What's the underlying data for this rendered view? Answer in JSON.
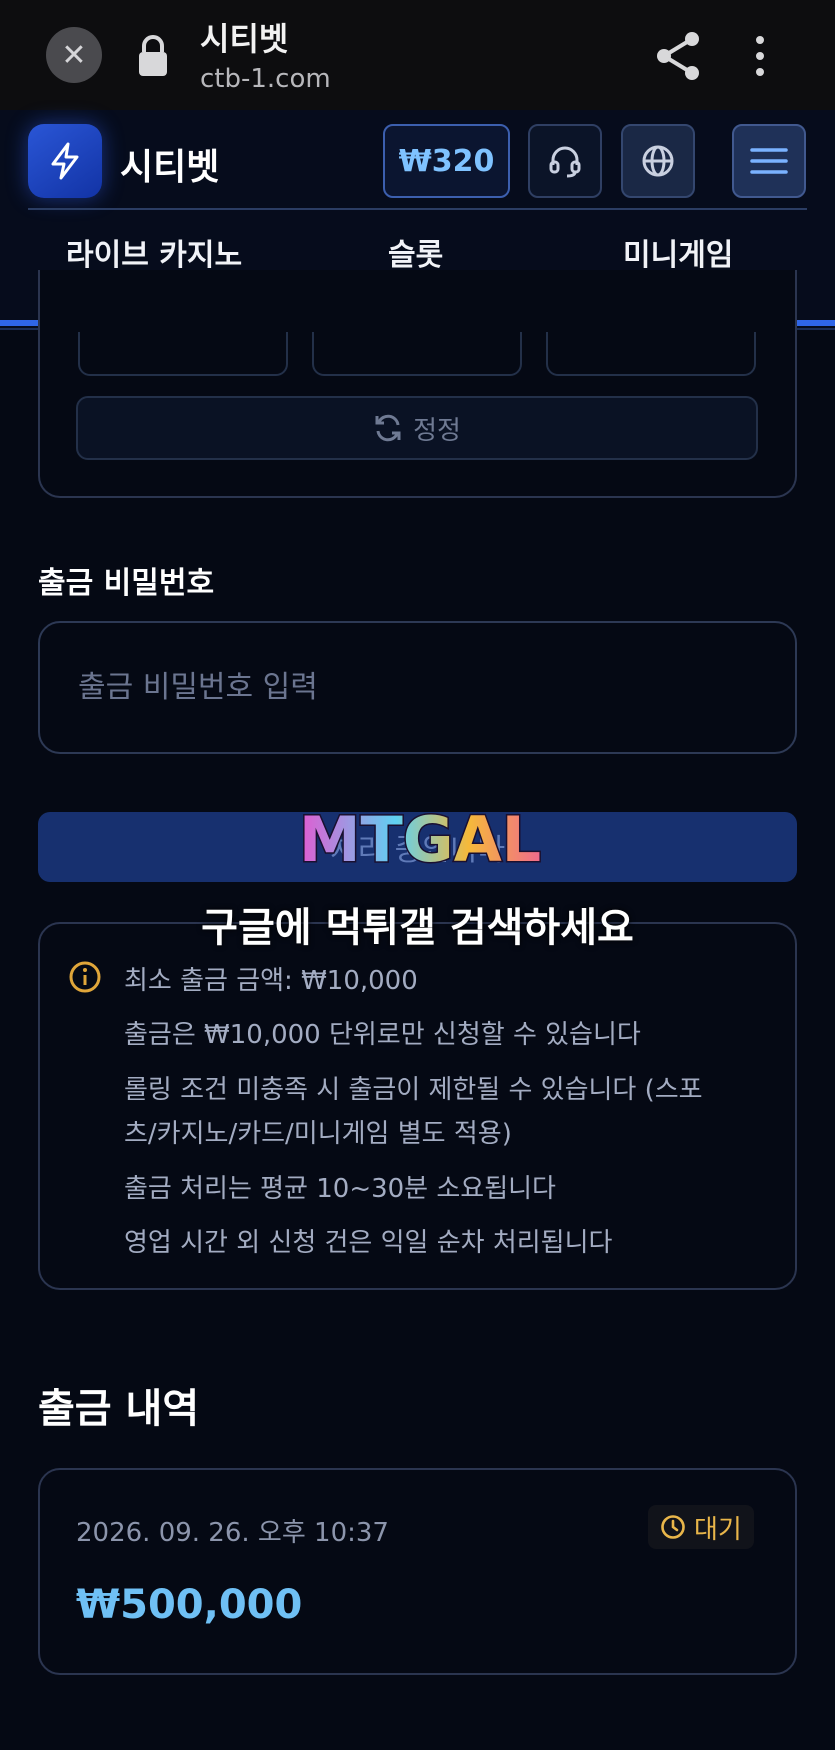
{
  "browser": {
    "title": "시티벳",
    "url": "ctb-1.com"
  },
  "header": {
    "site_name": "시티벳",
    "balance": "₩320"
  },
  "nav": {
    "items": [
      {
        "label": "라이브 카지노"
      },
      {
        "label": "슬롯"
      },
      {
        "label": "미니게임"
      }
    ]
  },
  "reset": {
    "label": "정정"
  },
  "withdraw_password": {
    "label": "출금 비밀번호",
    "placeholder": "출금 비밀번호 입력",
    "value": ""
  },
  "submit": {
    "label": "처리 중입니다"
  },
  "watermark": {
    "logo": "MTGAL",
    "text": "구글에 먹튀갤 검색하세요"
  },
  "info": {
    "lines": [
      "최소 출금 금액: ₩10,000",
      "출금은 ₩10,000 단위로만 신청할 수 있습니다",
      "롤링 조건 미충족 시 출금이 제한될 수 있습니다 (스포",
      "츠/카지노/카드/미니게임 별도 적용)",
      "출금 처리는 평균 10~30분 소요됩니다",
      "영업 시간 외 신청 건은 익일 순차 처리됩니다"
    ]
  },
  "history": {
    "title": "출금 내역",
    "entries": [
      {
        "date": "2026. 09. 26. 오후 10:37",
        "status": "대기",
        "amount": "₩500,000"
      }
    ]
  },
  "colors": {
    "accent": "#2f66e8",
    "amount": "#6fc0f5",
    "status_pending": "#e9b64a",
    "info_icon": "#e0a63a"
  }
}
